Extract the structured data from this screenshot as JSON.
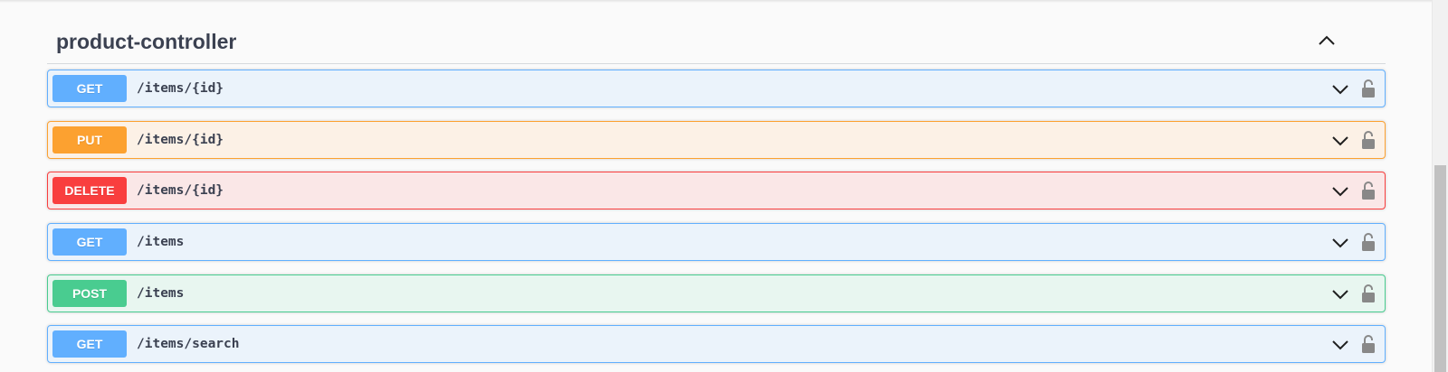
{
  "tag": {
    "title": "product-controller",
    "toggle_icon": "chevron-up-icon"
  },
  "operations": [
    {
      "method": "GET",
      "path": "/items/{id}",
      "type": "get"
    },
    {
      "method": "PUT",
      "path": "/items/{id}",
      "type": "put"
    },
    {
      "method": "DELETE",
      "path": "/items/{id}",
      "type": "delete"
    },
    {
      "method": "GET",
      "path": "/items",
      "type": "get"
    },
    {
      "method": "POST",
      "path": "/items",
      "type": "post"
    },
    {
      "method": "GET",
      "path": "/items/search",
      "type": "get"
    }
  ],
  "icons": {
    "expand": "chevron-down-icon",
    "authorize": "lock-open-icon"
  },
  "colors": {
    "get": "#61affe",
    "put": "#fca130",
    "delete": "#f93e3e",
    "post": "#49cc90",
    "title": "#3b4151"
  }
}
